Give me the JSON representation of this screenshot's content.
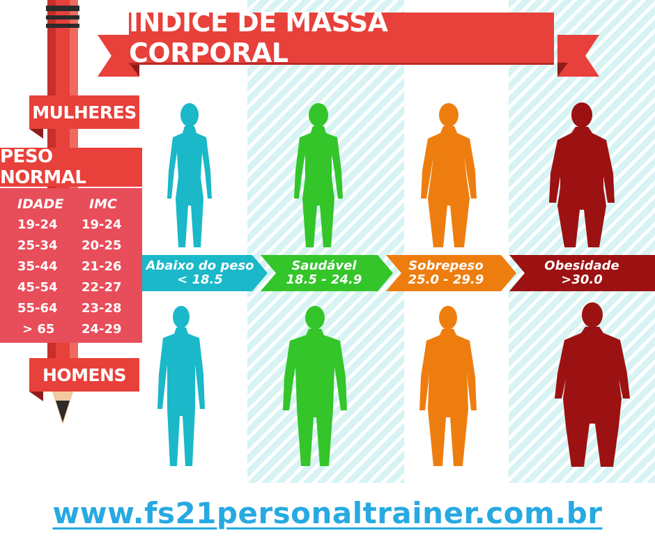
{
  "title": "ÍNDICE DE MASSA CORPORAL",
  "tags": {
    "women": "MULHERES",
    "normal_weight": "PESO NORMAL",
    "men": "HOMENS"
  },
  "table": {
    "headers": [
      "IDADE",
      "IMC"
    ],
    "rows": [
      [
        "19-24",
        "19-24"
      ],
      [
        "25-34",
        "20-25"
      ],
      [
        "35-44",
        "21-26"
      ],
      [
        "45-54",
        "22-27"
      ],
      [
        "55-64",
        "23-28"
      ],
      [
        "> 65",
        "24-29"
      ]
    ]
  },
  "categories": [
    {
      "name": "Abaixo do peso",
      "range": "< 18.5",
      "color": "#1ab8c9"
    },
    {
      "name": "Saudável",
      "range": "18.5 - 24.9",
      "color": "#34c52a"
    },
    {
      "name": "Sobrepeso",
      "range": "25.0 - 29.9",
      "color": "#ee7d0f"
    },
    {
      "name": "Obesidade",
      "range": ">30.0",
      "color": "#9c1111"
    }
  ],
  "website": "www.fs21personaltrainer.com.br",
  "icons": [
    "pencil-icon",
    "female-silhouette-icon",
    "male-silhouette-icon"
  ]
}
